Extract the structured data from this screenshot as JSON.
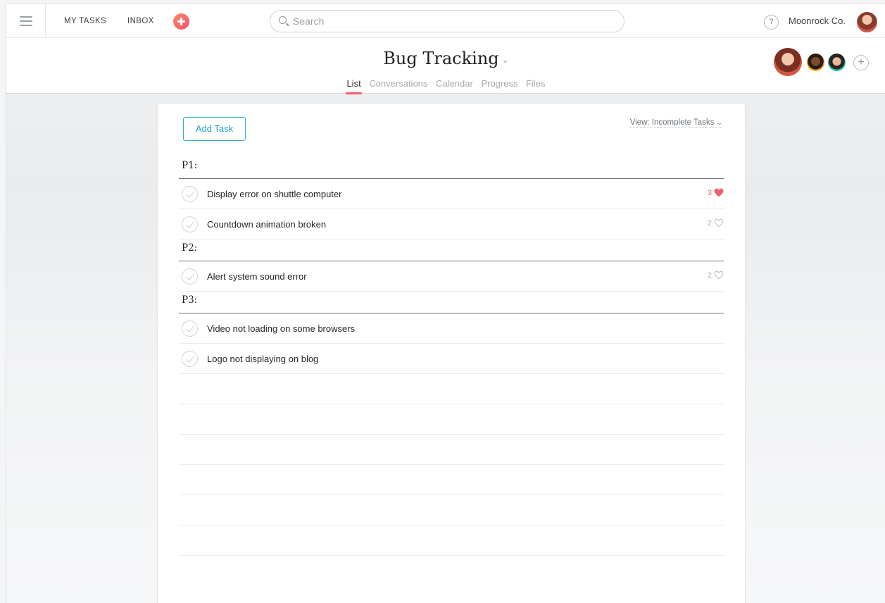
{
  "nav": {
    "my_tasks": "MY TASKS",
    "inbox": "INBOX",
    "search_placeholder": "Search",
    "help": "?",
    "org": "Moonrock Co."
  },
  "project": {
    "title": "Bug Tracking",
    "caret": "⌄",
    "tabs": [
      "List",
      "Conversations",
      "Calendar",
      "Progress",
      "Files"
    ],
    "active_tab": "List",
    "add_member": "+"
  },
  "toolbar": {
    "add_task": "Add Task",
    "view": "View: Incomplete Tasks",
    "view_caret": "⌄"
  },
  "sections": [
    {
      "label": "P1:",
      "tasks": [
        {
          "name": "Display error on shuttle computer",
          "likes": "3",
          "liked": true
        },
        {
          "name": "Countdown animation broken",
          "likes": "2",
          "liked": false
        }
      ]
    },
    {
      "label": "P2:",
      "tasks": [
        {
          "name": "Alert system sound error",
          "likes": "2",
          "liked": false
        }
      ]
    },
    {
      "label": "P3:",
      "tasks": [
        {
          "name": "Video not loading on some browsers",
          "likes": "",
          "liked": false
        },
        {
          "name": "Logo not displaying on blog",
          "likes": "",
          "liked": false
        }
      ]
    }
  ],
  "colors": {
    "accent_teal": "#1ea2bd",
    "tab_underline": "#f95c6b",
    "heart_liked": "#f25f6c",
    "quick_add": "#f0506e"
  },
  "icons": {
    "menu": "hamburger-icon",
    "quick_add": "plus-icon",
    "search": "search-icon",
    "check": "check-icon",
    "like": "heart-icon"
  }
}
